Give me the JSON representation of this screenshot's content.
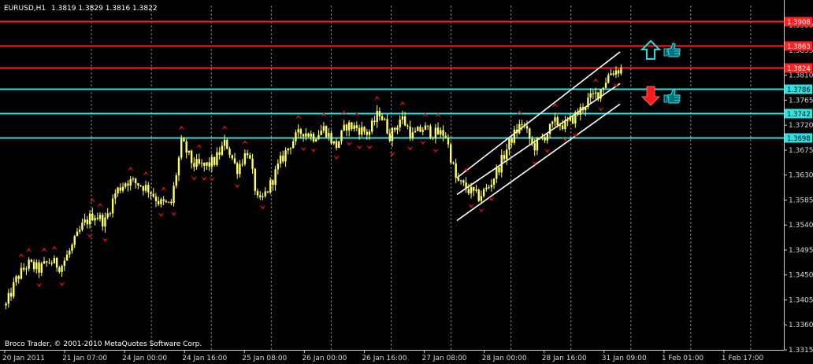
{
  "header": {
    "symbol": "EURUSD,H1",
    "ohlc": "1.3819 1.3829 1.3816 1.3822"
  },
  "footer": {
    "copyright": "Broco Trader, © 2001-2010 MetaQuotes Software Corp."
  },
  "colors": {
    "background": "#000000",
    "candles": "#ffff66",
    "resistance": "#ff2020",
    "support": "#33e0e0",
    "fractal": "#d01010",
    "channel": "#ffffff",
    "up_arrow": "#22dddd",
    "down_arrow": "#ff1a1a",
    "thumb": "#22cccc",
    "grid": "#cfcfcf"
  },
  "signals": {
    "up": {
      "arrow_icon": "up-arrow-icon",
      "thumb_icon": "thumbs-up-icon"
    },
    "down": {
      "arrow_icon": "down-arrow-icon",
      "thumb_icon": "thumbs-up-icon"
    }
  },
  "chart_data": {
    "type": "candlestick",
    "symbol": "EURUSD",
    "timeframe": "H1",
    "ylim": [
      1.3315,
      1.3935
    ],
    "y_ticks": [
      "1.3900",
      "1.3855",
      "1.3810",
      "1.3765",
      "1.3720",
      "1.3675",
      "1.3630",
      "1.3585",
      "1.3540",
      "1.3495",
      "1.3450",
      "1.3405",
      "1.3360",
      "1.3315"
    ],
    "x_ticks": [
      "20 Jan 2011",
      "21 Jan 07:00",
      "24 Jan 00:00",
      "24 Jan 16:00",
      "25 Jan 08:00",
      "26 Jan 00:00",
      "26 Jan 16:00",
      "27 Jan 08:00",
      "28 Jan 00:00",
      "28 Jan 16:00",
      "31 Jan 09:00",
      "1 Feb 01:00",
      "1 Feb 17:00"
    ],
    "vertical_grid": true,
    "horizontal_grid": false,
    "levels": [
      {
        "value": 1.3908,
        "label": "1.3908",
        "type": "resistance"
      },
      {
        "value": 1.3863,
        "label": "1.3863",
        "type": "resistance"
      },
      {
        "value": 1.3824,
        "label": "1.3824",
        "type": "resistance"
      },
      {
        "value": 1.3786,
        "label": "1.3786",
        "type": "support"
      },
      {
        "value": 1.3742,
        "label": "1.3742",
        "type": "support"
      },
      {
        "value": 1.3698,
        "label": "1.3698",
        "type": "support"
      }
    ],
    "price_path": [
      1.3395,
      1.3445,
      1.347,
      1.346,
      1.3475,
      1.3465,
      1.35,
      1.354,
      1.356,
      1.3545,
      1.36,
      1.362,
      1.3615,
      1.3605,
      1.358,
      1.3575,
      1.369,
      1.365,
      1.3645,
      1.3655,
      1.369,
      1.364,
      1.3675,
      1.3575,
      1.361,
      1.3655,
      1.369,
      1.371,
      1.37,
      1.3715,
      1.368,
      1.372,
      1.3715,
      1.3705,
      1.3745,
      1.37,
      1.3735,
      1.37,
      1.3715,
      1.3705,
      1.3705,
      1.362,
      1.3605,
      1.359,
      1.361,
      1.365,
      1.3695,
      1.3725,
      1.368,
      1.37,
      1.3725,
      1.372,
      1.374,
      1.3765,
      1.378,
      1.3815,
      1.3822
    ]
  }
}
